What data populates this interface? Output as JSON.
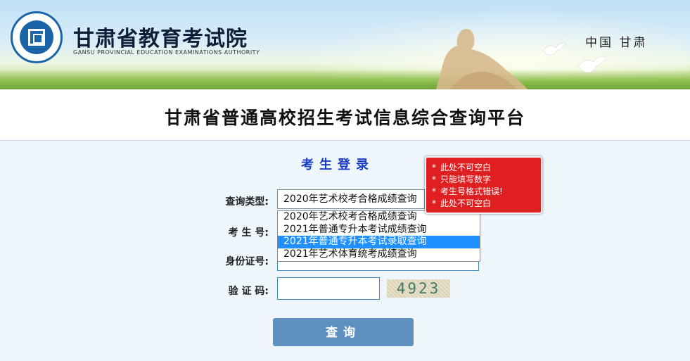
{
  "header": {
    "org_name_cn": "甘肃省教育考试院",
    "org_name_en": "GANSU PROVINCIAL EDUCATION EXAMINATIONS AUTHORITY",
    "region": "中国  甘肃"
  },
  "platform_title": "甘肃省普通高校招生考试信息综合查询平台",
  "login": {
    "title": "考生登录",
    "labels": {
      "query_type": "查询类型:",
      "exam_number": "考 生 号:",
      "id_number": "身份证号:",
      "captcha": "验 证 码:"
    },
    "query_type_selected": "2020年艺术校考合格成绩查询",
    "query_type_options": [
      "2020年艺术校考合格成绩查询",
      "2021年普通专升本考试成绩查询",
      "2021年普通专升本考试录取查询",
      "2021年艺术体育统考成绩查询"
    ],
    "highlighted_option_index": 2,
    "captcha_code": "4923",
    "submit_label": "查询"
  },
  "errors": [
    "此处不可空白",
    "只能填写数字",
    "考生号格式错误!",
    "此处不可空白"
  ],
  "colors": {
    "accent_blue": "#1a3fc6",
    "button": "#5f8fbf",
    "error_bg": "#e02020",
    "highlight": "#1e90ff"
  }
}
